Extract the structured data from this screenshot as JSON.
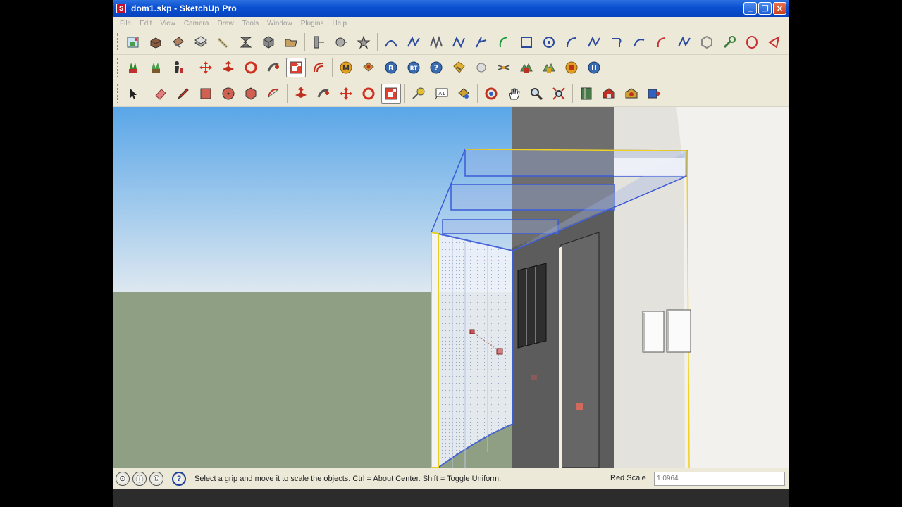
{
  "window": {
    "title": "dom1.skp - SketchUp Pro",
    "app_icon": "sketchup-logo-icon",
    "buttons": [
      "minimize",
      "maximize",
      "close"
    ]
  },
  "menu": [
    "File",
    "Edit",
    "View",
    "Camera",
    "Draw",
    "Tools",
    "Window",
    "Plugins",
    "Help"
  ],
  "toolbars": {
    "row1": [
      "get-photo-texture-icon",
      "component-icon",
      "paint-bucket-icon",
      "push-pull-icon",
      "tape-measure-icon",
      "extrude-icon",
      "box-icon",
      "open-folder-icon",
      "section-plane-icon",
      "sphere-icon",
      "star-icon",
      "bezier-arc-icon",
      "curve-icon",
      "freehand-icon",
      "polyline-icon",
      "spline-icon",
      "arc-icon",
      "rectangle-icon",
      "circle-icon",
      "arc-2-icon",
      "zigzag-icon",
      "hook-icon",
      "curve-2-icon",
      "arc-3-icon",
      "line-icon",
      "polygon-icon",
      "wrench-icon",
      "ellipse-icon",
      "shape-icon"
    ],
    "row2": [
      "plant-icon",
      "tree-icon",
      "figure-icon",
      "move-icon",
      "push-icon",
      "rotate-icon",
      "follow-me-icon",
      "scale-icon",
      "offset-icon",
      "m-icon",
      "gear-icon",
      "r-icon",
      "rt-icon",
      "help-icon",
      "tag-icon",
      "sphere-2-icon",
      "connect-icon",
      "landscape-icon",
      "landscape-2-icon",
      "target-icon",
      "pause-icon"
    ],
    "row3": [
      "select-icon",
      "eraser-icon",
      "pencil-icon",
      "rectangle-tool-icon",
      "circle-tool-icon",
      "polygon-tool-icon",
      "arc-tool-icon",
      "push-pull-tool-icon",
      "follow-me-tool-icon",
      "move-tool-icon",
      "rotate-tool-icon",
      "scale-tool-icon",
      "tape-measure-tool-icon",
      "text-tool-icon",
      "paint-tool-icon",
      "orbit-icon",
      "pan-icon",
      "zoom-icon",
      "zoom-extents-icon",
      "walk-icon",
      "warehouse-icon",
      "components-icon",
      "send-icon"
    ],
    "active_tool": "scale-tool-icon"
  },
  "viewport": {
    "sky_top": "#5aa6e8",
    "sky_bottom": "#dde8f0",
    "ground": "#8f9f84"
  },
  "statusbar": {
    "icons": [
      "geo-location-icon",
      "credits-icon",
      "license-icon",
      "help-icon"
    ],
    "message": "Select a grip and move it to scale the objects. Ctrl = About Center. Shift = Toggle Uniform.",
    "vcb_label": "Red Scale",
    "vcb_value": "1.0964"
  }
}
